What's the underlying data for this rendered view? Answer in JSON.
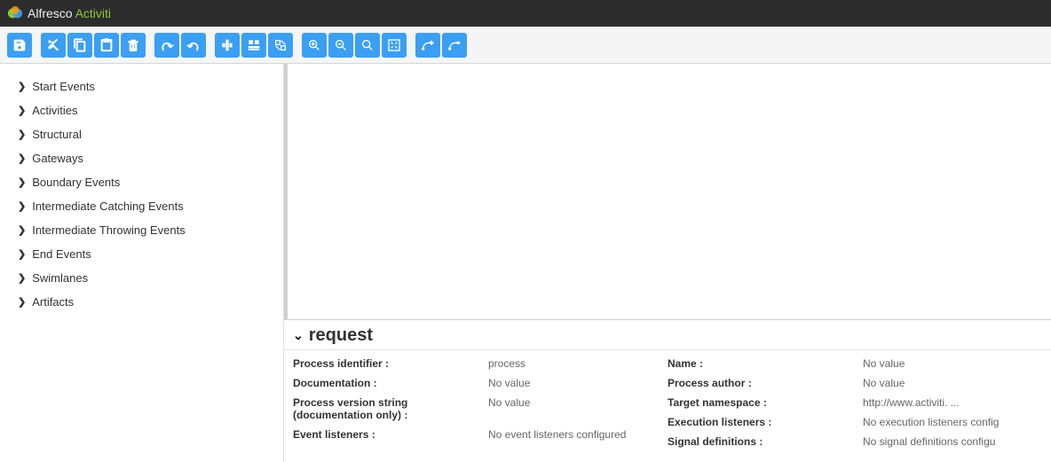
{
  "brand": {
    "part1": "Alfresco",
    "part2": "Activiti"
  },
  "sidebar": {
    "items": [
      {
        "label": "Start Events"
      },
      {
        "label": "Activities"
      },
      {
        "label": "Structural"
      },
      {
        "label": "Gateways"
      },
      {
        "label": "Boundary Events"
      },
      {
        "label": "Intermediate Catching Events"
      },
      {
        "label": "Intermediate Throwing Events"
      },
      {
        "label": "End Events"
      },
      {
        "label": "Swimlanes"
      },
      {
        "label": "Artifacts"
      }
    ]
  },
  "properties": {
    "title": "request",
    "left": [
      {
        "label": "Process identifier :",
        "value": "process"
      },
      {
        "label": "Documentation :",
        "value": "No value"
      },
      {
        "label": "Process version string (documentation only) :",
        "value": "No value"
      },
      {
        "label": "Event listeners :",
        "value": "No event listeners configured"
      }
    ],
    "right": [
      {
        "label": "Name :",
        "value": "No value"
      },
      {
        "label": "Process author :",
        "value": "No value"
      },
      {
        "label": "Target namespace :",
        "value": "http://www.activiti. ..."
      },
      {
        "label": "Execution listeners :",
        "value": "No execution listeners config"
      },
      {
        "label": "Signal definitions :",
        "value": "No signal definitions configu"
      }
    ]
  },
  "toolbar": {
    "groups": [
      [
        "save"
      ],
      [
        "cut",
        "copy",
        "paste",
        "delete"
      ],
      [
        "redo",
        "undo"
      ],
      [
        "align-v",
        "align-h",
        "same-size"
      ],
      [
        "zoom-in",
        "zoom-out",
        "zoom-fit",
        "zoom-actual"
      ],
      [
        "bend-add",
        "bend-remove"
      ]
    ]
  }
}
